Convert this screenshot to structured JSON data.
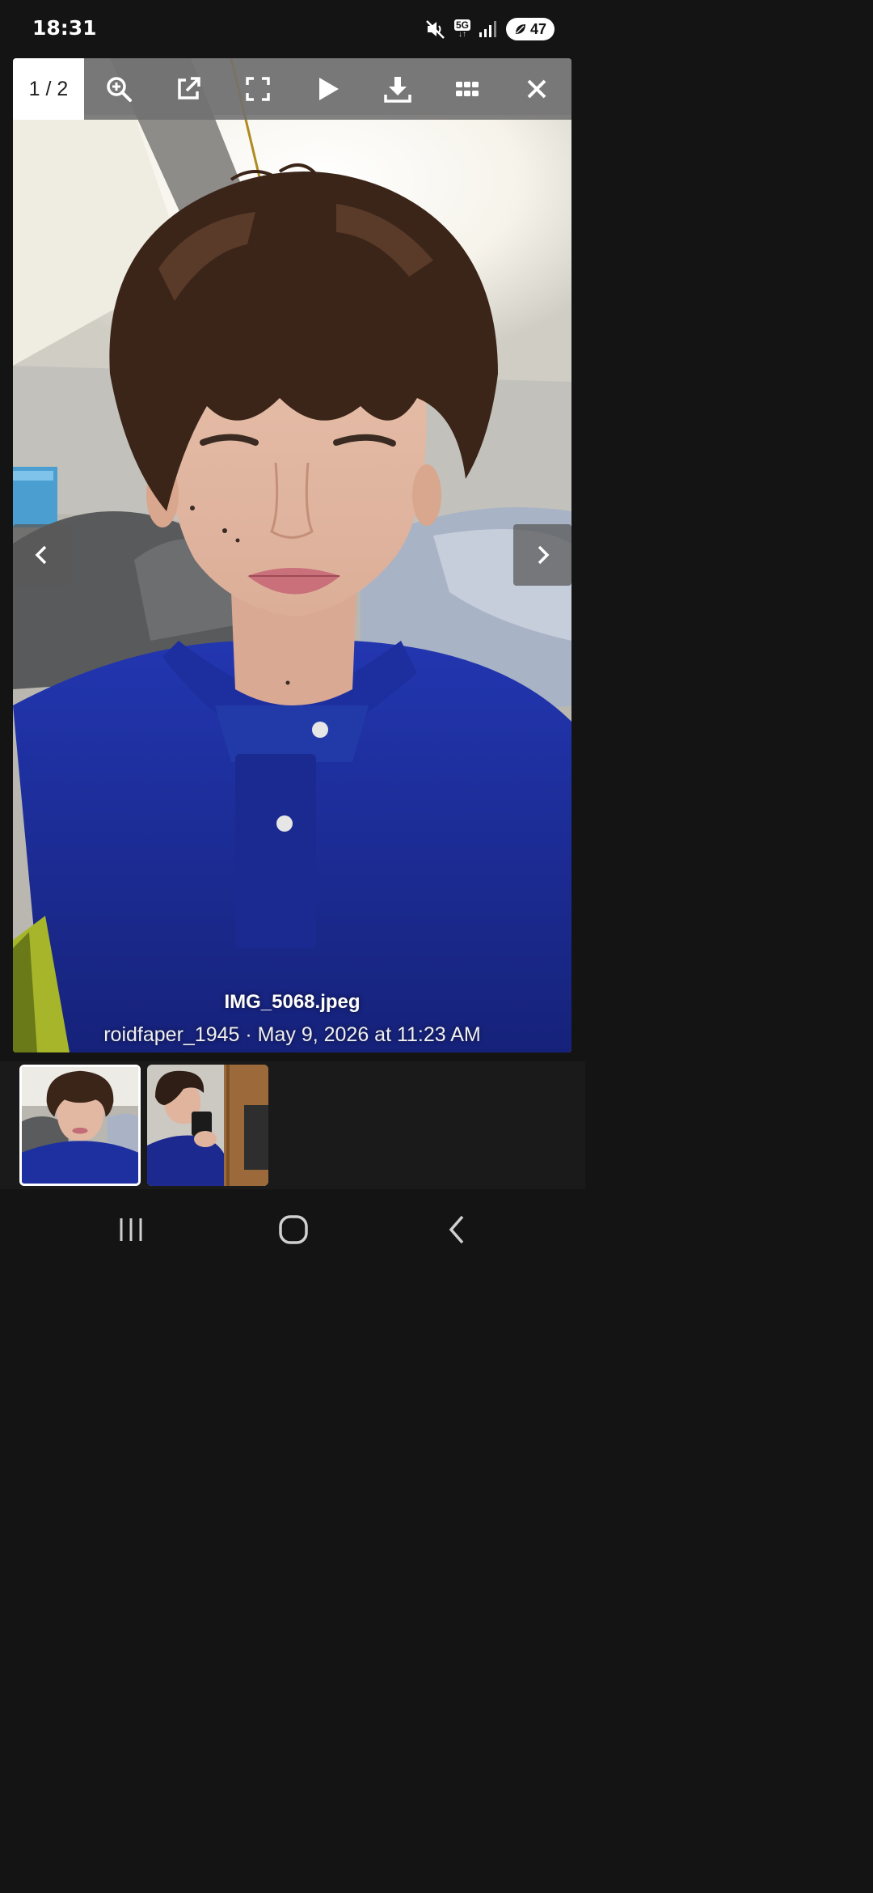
{
  "status_bar": {
    "time": "18:31",
    "network": "5G",
    "battery": "47",
    "icons": [
      "mute-icon",
      "5g-icon",
      "signal-icon",
      "battery-icon"
    ]
  },
  "viewer": {
    "counter": "1 / 2",
    "toolbar": [
      {
        "name": "zoom-in-button",
        "icon": "zoom-in-icon"
      },
      {
        "name": "open-external-button",
        "icon": "external-link-icon"
      },
      {
        "name": "fullscreen-button",
        "icon": "fullscreen-icon"
      },
      {
        "name": "slideshow-button",
        "icon": "play-icon"
      },
      {
        "name": "download-button",
        "icon": "download-icon"
      },
      {
        "name": "grid-view-button",
        "icon": "grid-icon"
      },
      {
        "name": "close-button",
        "icon": "close-icon"
      }
    ],
    "caption": {
      "filename": "IMG_5068.jpeg",
      "meta": "roidfaper_1945 · May 9, 2026 at 11:23 AM"
    },
    "colors": {
      "toolbar_bg": "#707070",
      "shirt": "#1c2d9b",
      "hair": "#3b2519"
    }
  },
  "thumbnails": [
    {
      "selected": true
    },
    {
      "selected": false
    }
  ],
  "nav_bar": {
    "buttons": [
      "recent-apps-icon",
      "home-icon",
      "back-icon"
    ]
  }
}
